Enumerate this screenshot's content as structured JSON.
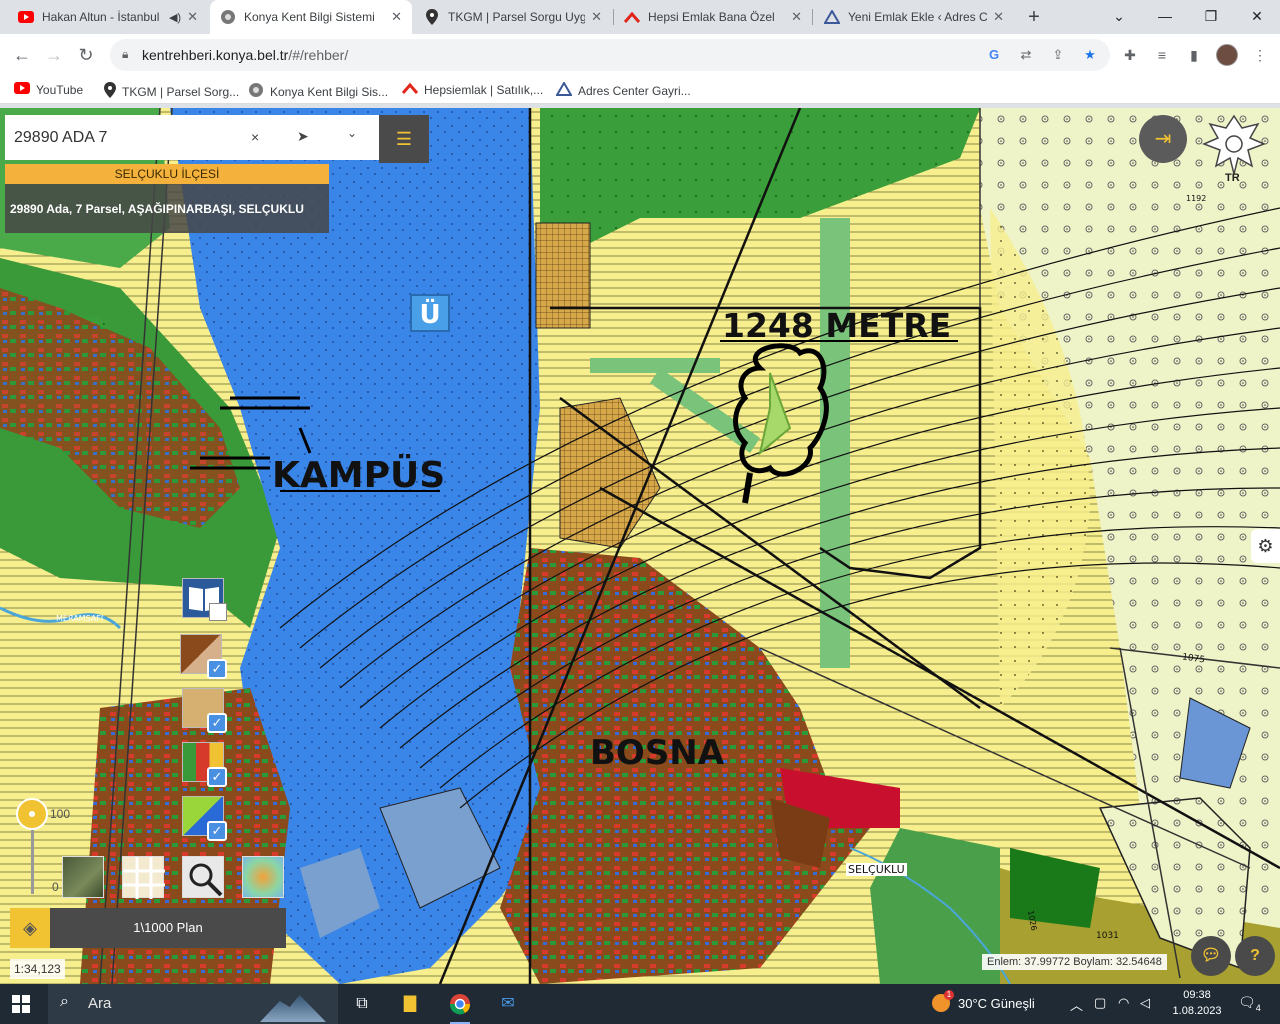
{
  "browser": {
    "tabs": [
      {
        "title": "Hakan Altun - İstanbul",
        "icon": "youtube-icon",
        "audio": true,
        "active": false
      },
      {
        "title": "Konya Kent Bilgi Sistemi",
        "icon": "globe-icon",
        "active": true
      },
      {
        "title": "TKGM | Parsel Sorgu Uygul",
        "icon": "location-pin-icon",
        "active": false
      },
      {
        "title": "Hepsi Emlak Bana Özel",
        "icon": "hepsiemlak-icon",
        "active": false
      },
      {
        "title": "Yeni Emlak Ekle ‹ Adres Ce",
        "icon": "adres-center-icon",
        "active": false
      }
    ],
    "new_tab_label": "+",
    "url_host": "kentrehberi.konya.bel.tr",
    "url_path": "/#/rehber/",
    "bookmarks": [
      {
        "label": "YouTube",
        "icon": "youtube-icon"
      },
      {
        "label": "TKGM | Parsel Sorg...",
        "icon": "location-pin-icon"
      },
      {
        "label": "Konya Kent Bilgi Sis...",
        "icon": "globe-icon"
      },
      {
        "label": "Hepsiemlak | Satılık,...",
        "icon": "hepsiemlak-icon"
      },
      {
        "label": "Adres Center Gayri...",
        "icon": "adres-center-icon"
      }
    ]
  },
  "app": {
    "search": {
      "value": "29890 ADA 7",
      "clear": "×"
    },
    "district_label": "SELÇUKLU İLÇESİ",
    "result_text": "29890 Ada, 7 Parsel, AŞAĞIPINARBAŞI, SELÇUKLU",
    "emblem_text": "TR",
    "slider": {
      "max_label": "100",
      "min_label": "0",
      "value_percent": 100
    },
    "plan_label": "1\\1000 Plan",
    "scale_text": "1:34,123",
    "coords_text": "Enlem: 37.99772 Boylam: 32.54648",
    "help_label": "?",
    "map_labels": {
      "metre": "1248 METRE",
      "kampus": "KAMPÜS",
      "bosna": "BOSNA",
      "selcuklu": "SELÇUKLU",
      "u_symbol": "Ü",
      "meramsaf": "MERAMSAFI"
    },
    "parcel_numbers": [
      "1075",
      "1031",
      "1192",
      "1026"
    ]
  },
  "taskbar": {
    "search_placeholder": "Ara",
    "weather": "30°C  Güneşli",
    "time": "09:38",
    "date": "1.08.2023",
    "notifications": "4"
  },
  "colors": {
    "accent_yellow": "#f1c232",
    "district_orange": "#f4b23c",
    "panel_dark": "#4a4a4a"
  }
}
